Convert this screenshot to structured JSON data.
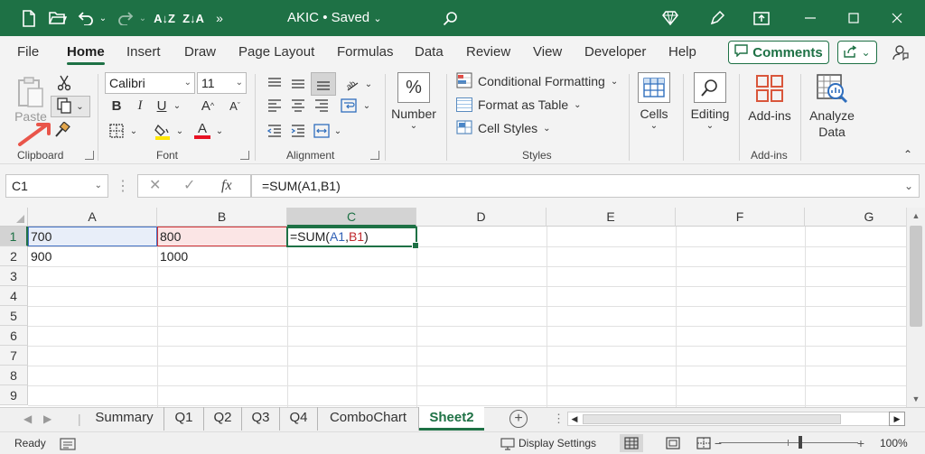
{
  "titlebar": {
    "doc_name": "AKIC",
    "saved_status": "• Saved",
    "accent": "#1e7145"
  },
  "menu": {
    "tabs": [
      "File",
      "Home",
      "Insert",
      "Draw",
      "Page Layout",
      "Formulas",
      "Data",
      "Review",
      "View",
      "Developer",
      "Help"
    ],
    "active_tab": "Home",
    "comments_label": "Comments"
  },
  "ribbon": {
    "clipboard": {
      "paste_label": "Paste",
      "group_label": "Clipboard"
    },
    "font": {
      "font_name": "Calibri",
      "font_size": "11",
      "group_label": "Font"
    },
    "alignment": {
      "group_label": "Alignment"
    },
    "number": {
      "label": "Number"
    },
    "styles": {
      "conditional_formatting": "Conditional Formatting",
      "format_as_table": "Format as Table",
      "cell_styles": "Cell Styles",
      "group_label": "Styles"
    },
    "cells_label": "Cells",
    "editing_label": "Editing",
    "addins": {
      "label": "Add-ins",
      "group_label": "Add-ins"
    },
    "analyze": {
      "line1": "Analyze",
      "line2": "Data"
    }
  },
  "formula_bar": {
    "name_box": "C1",
    "fx": "fx",
    "formula": "=SUM(A1,B1)"
  },
  "grid": {
    "columns": [
      "A",
      "B",
      "C",
      "D",
      "E",
      "F",
      "G"
    ],
    "rows": [
      "1",
      "2",
      "3",
      "4",
      "5",
      "6",
      "7",
      "8",
      "9"
    ],
    "cells": {
      "A1": "700",
      "B1": "800",
      "A2": "900",
      "B2": "1000"
    },
    "c1_formula": {
      "prefix": "=SUM(",
      "ref1": "A1",
      "comma": ",",
      "ref2": "B1",
      "suffix": ")"
    },
    "selected_cell": "C1"
  },
  "sheets": {
    "tabs": [
      "Summary",
      "Q1",
      "Q2",
      "Q3",
      "Q4",
      "ComboChart",
      "Sheet2"
    ],
    "active": "Sheet2"
  },
  "status": {
    "ready": "Ready",
    "display_settings": "Display Settings",
    "zoom": "100%"
  }
}
